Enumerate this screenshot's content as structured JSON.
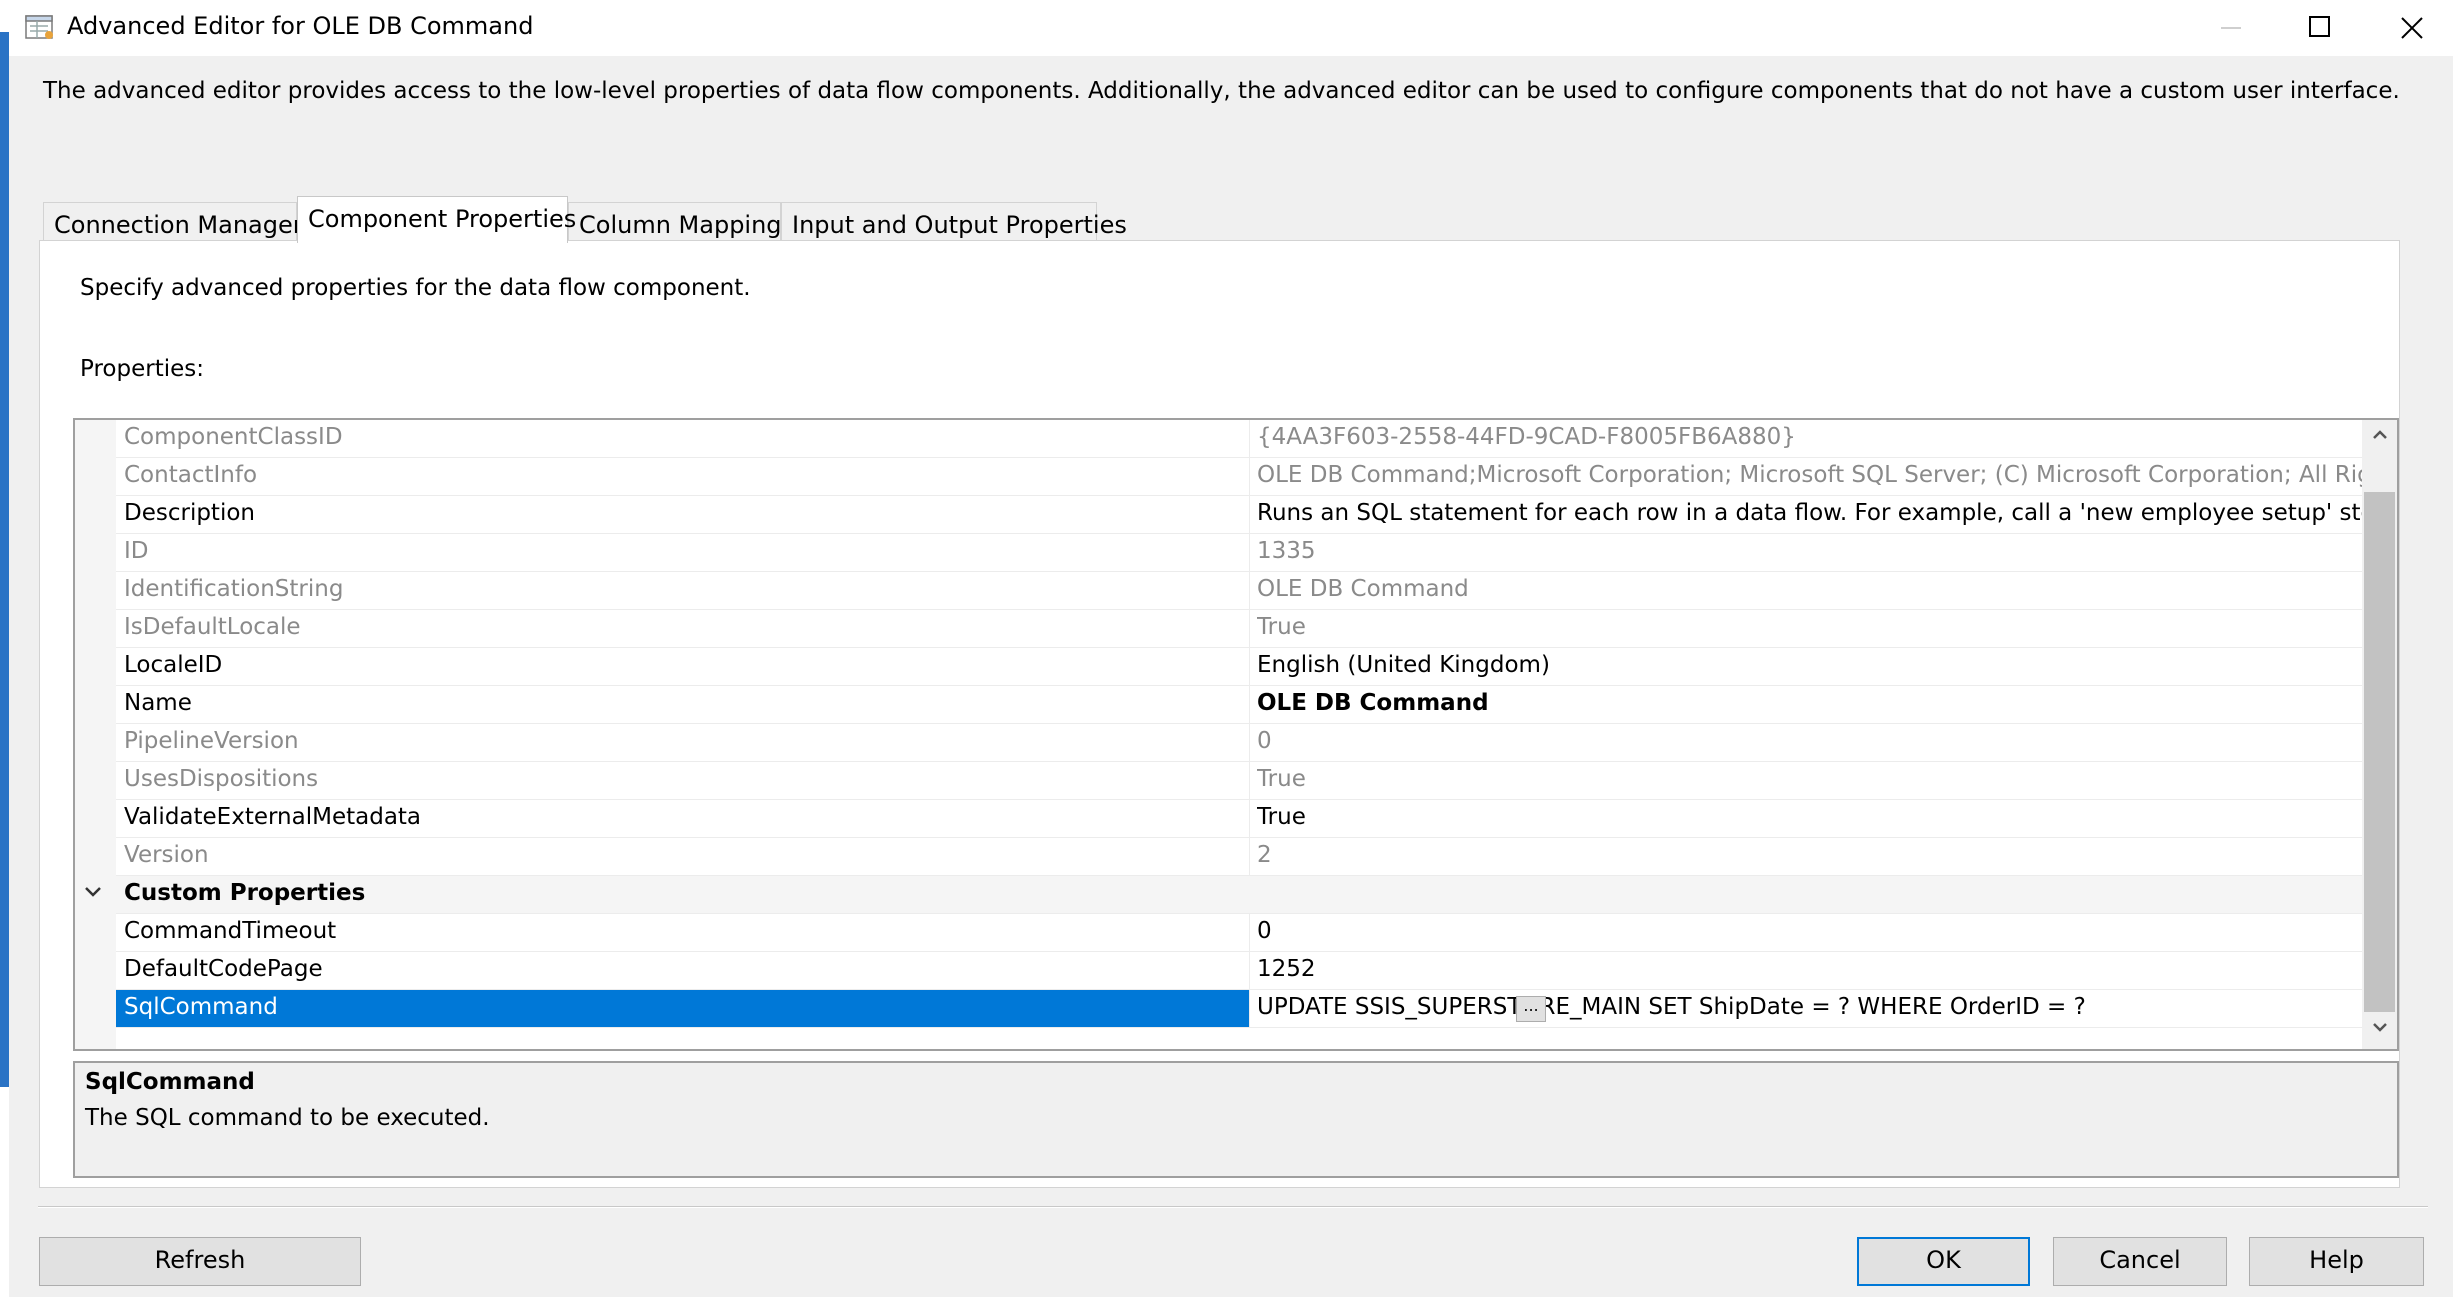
{
  "window": {
    "title": "Advanced Editor for OLE DB Command",
    "intro": "The advanced editor provides access to the low-level properties of data flow components. Additionally, the advanced editor can be used to configure components that do not have a custom user interface."
  },
  "tabs": [
    {
      "label": "Connection Managers",
      "active": false
    },
    {
      "label": "Component Properties",
      "active": true
    },
    {
      "label": "Column Mappings",
      "active": false
    },
    {
      "label": "Input and Output Properties",
      "active": false
    }
  ],
  "panel": {
    "description": "Specify advanced properties for the data flow component.",
    "properties_label": "Properties:"
  },
  "properties": [
    {
      "name": "ComponentClassID",
      "value": "{4AA3F603-2558-44FD-9CAD-F8005FB6A880}",
      "readonly": true
    },
    {
      "name": "ContactInfo",
      "value": "OLE DB Command;Microsoft Corporation; Microsoft SQL Server; (C) Microsoft Corporation; All Rights Reserved",
      "readonly": true
    },
    {
      "name": "Description",
      "value": "Runs an SQL statement for each row in a data flow. For example, call a 'new employee setup' stored procedure",
      "readonly": false
    },
    {
      "name": "ID",
      "value": "1335",
      "readonly": true
    },
    {
      "name": "IdentificationString",
      "value": "OLE DB Command",
      "readonly": true
    },
    {
      "name": "IsDefaultLocale",
      "value": "True",
      "readonly": true
    },
    {
      "name": "LocaleID",
      "value": "English (United Kingdom)",
      "readonly": false
    },
    {
      "name": "Name",
      "value": "OLE DB Command",
      "readonly": false,
      "bold_value": true
    },
    {
      "name": "PipelineVersion",
      "value": "0",
      "readonly": true
    },
    {
      "name": "UsesDispositions",
      "value": "True",
      "readonly": true
    },
    {
      "name": "ValidateExternalMetadata",
      "value": "True",
      "readonly": false
    },
    {
      "name": "Version",
      "value": "2",
      "readonly": true
    }
  ],
  "custom_category": {
    "label": "Custom Properties",
    "expanded": true
  },
  "custom_properties": [
    {
      "name": "CommandTimeout",
      "value": "0"
    },
    {
      "name": "DefaultCodePage",
      "value": "1252"
    },
    {
      "name": "SqlCommand",
      "value": "UPDATE SSIS_SUPERSTORE_MAIN SET ShipDate = ?  WHERE OrderID = ?",
      "selected": true
    }
  ],
  "ellipsis_label": "...",
  "description_box": {
    "title": "SqlCommand",
    "text": "The SQL command to be executed."
  },
  "buttons": {
    "refresh": "Refresh",
    "ok": "OK",
    "cancel": "Cancel",
    "help": "Help"
  },
  "colors": {
    "selection": "#0078d7",
    "readonly_text": "#8a8a8a"
  }
}
